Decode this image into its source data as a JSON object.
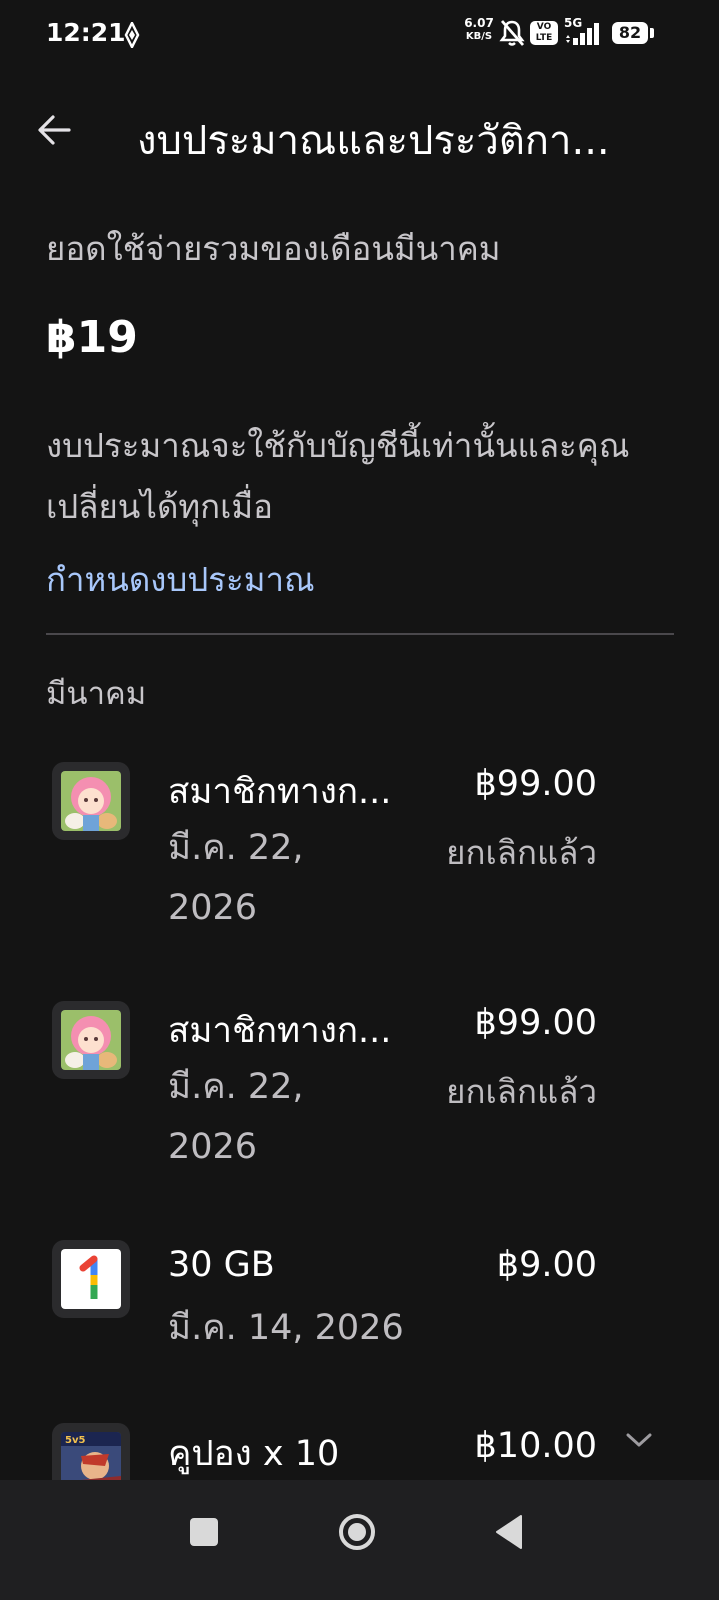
{
  "status_bar": {
    "time": "12:21",
    "net_speed_value": "6.07",
    "net_speed_unit": "KB/S",
    "volte_top": "VO",
    "volte_bottom": "LTE",
    "network": "5G",
    "battery": "82"
  },
  "header": {
    "title": "งบประมาณและประวัติกา..."
  },
  "summary": {
    "label": "ยอดใช้จ่ายรวมของเดือนมีนาคม",
    "total": "฿19",
    "note": "งบประมาณจะใช้กับบัญชีนี้เท่านั้นและคุณเปลี่ยนได้ทุกเมื่อ",
    "set_budget_link": "กำหนดงบประมาณ"
  },
  "month_heading": "มีนาคม",
  "transactions": [
    {
      "name": "สมาชิกทางก...",
      "price": "฿99.00",
      "date": "มี.ค. 22, 2026",
      "status": "ยกเลิกแล้ว",
      "icon": "game-avatar-icon"
    },
    {
      "name": "สมาชิกทางก...",
      "price": "฿99.00",
      "date": "มี.ค. 22, 2026",
      "status": "ยกเลิกแล้ว",
      "icon": "game-avatar-icon"
    },
    {
      "name": "30 GB",
      "price": "฿9.00",
      "date": "มี.ค. 14, 2026",
      "status": "",
      "icon": "google-one-icon"
    },
    {
      "name": "คูปอง x 10",
      "price": "฿10.00",
      "date": "",
      "status": "",
      "icon": "moba-game-icon"
    }
  ],
  "colors": {
    "background": "#141414",
    "link": "#a8c7fa",
    "nav_bar": "#1f1f21"
  }
}
